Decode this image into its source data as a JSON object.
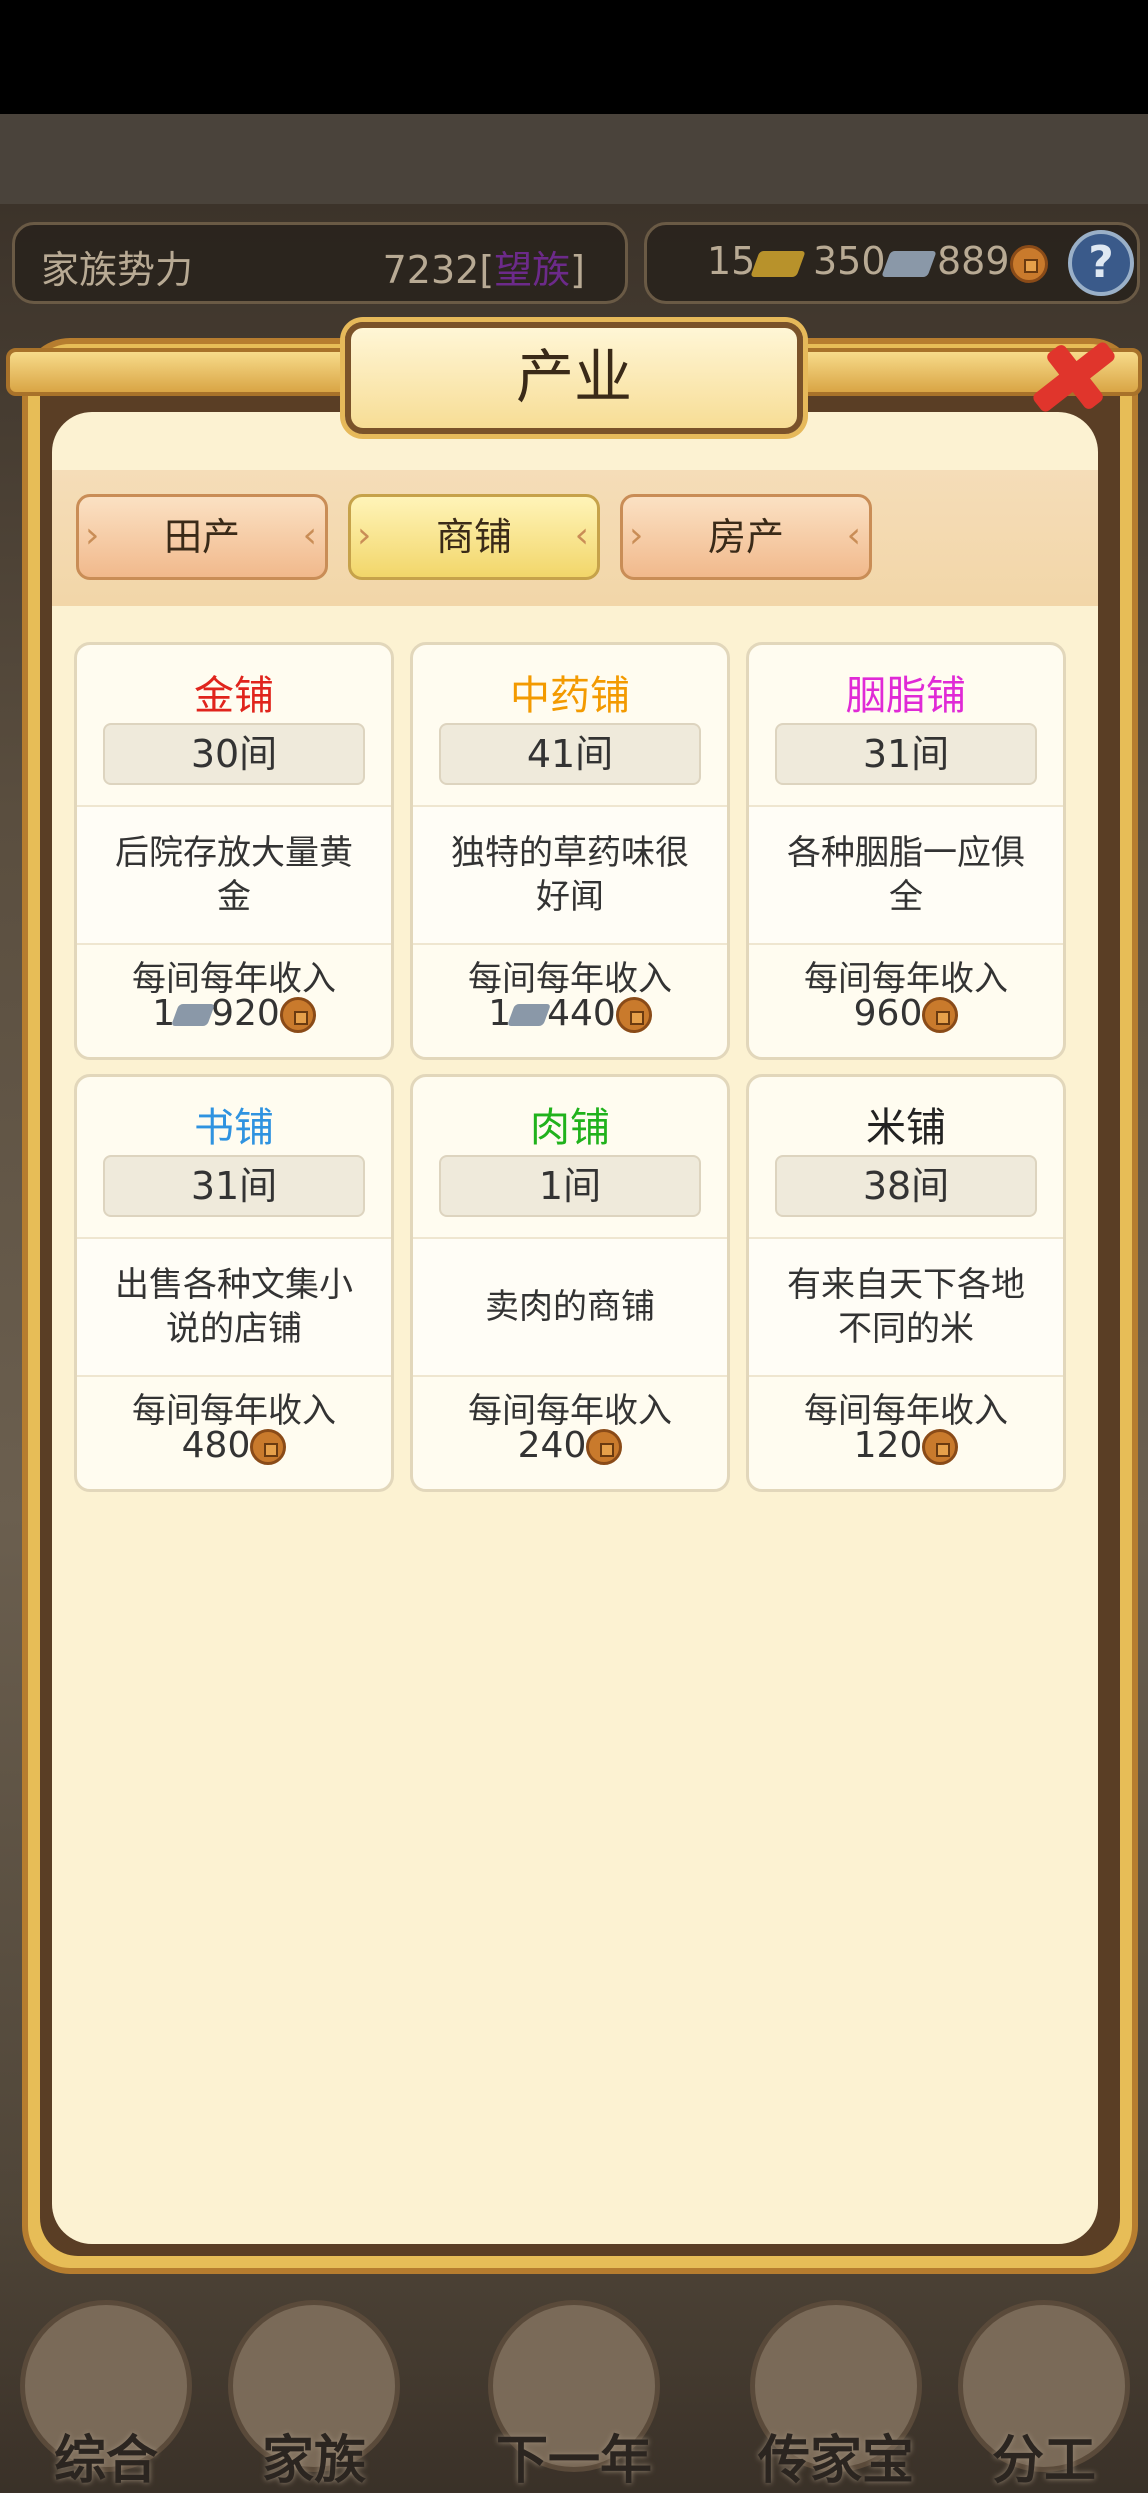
{
  "top": {
    "clan_power_label": "家族势力",
    "clan_power_value": "7232",
    "clan_power_rank": "望族",
    "gold": "15",
    "silver": "350",
    "coins": "889",
    "help_symbol": "?"
  },
  "modal": {
    "title": "产业",
    "tabs": [
      {
        "label": "田产",
        "active": false
      },
      {
        "label": "商铺",
        "active": true
      },
      {
        "label": "房产",
        "active": false
      }
    ],
    "shops": [
      {
        "name": "金铺",
        "color": "#e0241c",
        "count": "30间",
        "desc": "后院存放大量黄金",
        "income_label": "每间每年收入",
        "silver": "1",
        "coins": "920"
      },
      {
        "name": "中药铺",
        "color": "#f39a00",
        "count": "41间",
        "desc": "独特的草药味很好闻",
        "income_label": "每间每年收入",
        "silver": "1",
        "coins": "440"
      },
      {
        "name": "胭脂铺",
        "color": "#e02ad6",
        "count": "31间",
        "desc": "各种胭脂一应俱全",
        "income_label": "每间每年收入",
        "silver": "",
        "coins": "960"
      },
      {
        "name": "书铺",
        "color": "#2f93e0",
        "count": "31间",
        "desc": "出售各种文集小说的店铺",
        "income_label": "每间每年收入",
        "silver": "",
        "coins": "480"
      },
      {
        "name": "肉铺",
        "color": "#20b21c",
        "count": "1间",
        "desc": "卖肉的商铺",
        "income_label": "每间每年收入",
        "silver": "",
        "coins": "240"
      },
      {
        "name": "米铺",
        "color": "#222222",
        "count": "38间",
        "desc": "有来自天下各地不同的米",
        "income_label": "每间每年收入",
        "silver": "",
        "coins": "120"
      }
    ]
  },
  "bottom_nav": [
    {
      "label": "综合"
    },
    {
      "label": "家族"
    },
    {
      "label": "下一年"
    },
    {
      "label": "传家宝"
    },
    {
      "label": "分工"
    }
  ]
}
